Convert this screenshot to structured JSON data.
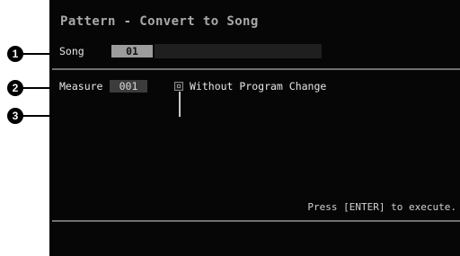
{
  "screen": {
    "title": "Pattern - Convert to Song",
    "song": {
      "label": "Song",
      "value": "01"
    },
    "measure": {
      "label": "Measure",
      "value": "001"
    },
    "option": {
      "label": "Without Program Change",
      "checked": false
    },
    "hint": "Press [ENTER] to execute."
  },
  "callouts": [
    {
      "number": "1",
      "target": "song"
    },
    {
      "number": "2",
      "target": "measure"
    },
    {
      "number": "3",
      "target": "without-program-change"
    }
  ]
}
